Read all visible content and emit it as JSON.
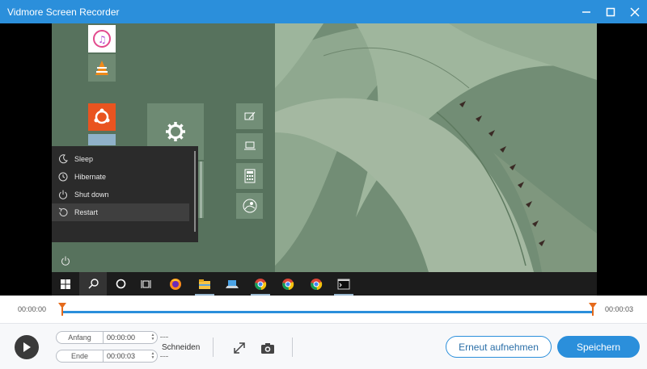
{
  "window": {
    "title": "Vidmore Screen Recorder",
    "accent_color": "#2b8fdb",
    "controls": [
      "minimize-icon",
      "maximize-icon",
      "close-icon"
    ]
  },
  "preview": {
    "power_menu": {
      "items": [
        {
          "label": "Sleep",
          "icon": "moon-icon"
        },
        {
          "label": "Hibernate",
          "icon": "clock-icon"
        },
        {
          "label": "Shut down",
          "icon": "power-icon"
        },
        {
          "label": "Restart",
          "icon": "restart-icon",
          "highlighted": true
        }
      ]
    },
    "taskbar_icons": [
      "windows-icon",
      "search-icon",
      "cortana-icon",
      "task-view-icon",
      "firefox-icon",
      "file-explorer-icon",
      "laptop-icon",
      "chrome-icon",
      "chrome-icon",
      "chrome-icon",
      "terminal-icon"
    ]
  },
  "timeline": {
    "start_time": "00:00:00",
    "end_time": "00:00:03"
  },
  "controls": {
    "start_label": "Anfang",
    "start_value": "00:00:00",
    "end_label": "Ende",
    "end_value": "00:00:03",
    "cut_label": "Schneiden",
    "rerecord_label": "Erneut aufnehmen",
    "save_label": "Speichern"
  }
}
